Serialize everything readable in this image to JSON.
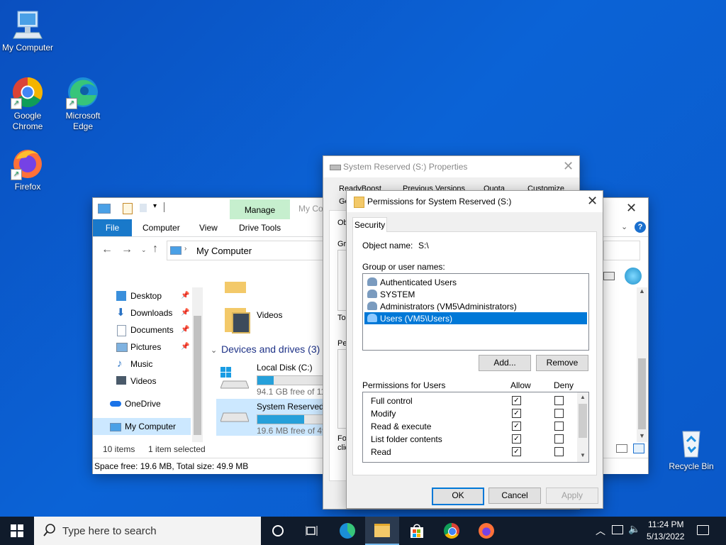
{
  "desktop": {
    "icons": [
      {
        "label": "My Computer"
      },
      {
        "label": "Google Chrome"
      },
      {
        "label": "Microsoft Edge"
      },
      {
        "label": "Firefox"
      },
      {
        "label": "Recycle Bin"
      }
    ]
  },
  "explorer": {
    "quick_access_partial": "My Co",
    "manage_tab": "Manage",
    "ribbon_tabs": [
      "File",
      "Computer",
      "View",
      "Drive Tools"
    ],
    "address": "My Computer",
    "nav_items": [
      "Desktop",
      "Downloads",
      "Documents",
      "Pictures",
      "Music",
      "Videos",
      "OneDrive",
      "My Computer"
    ],
    "folder_videos": "Videos",
    "devices_header": "Devices and drives (3)",
    "drives": [
      {
        "name": "Local Disk (C:)",
        "free": "94.1 GB free of 119",
        "fill": 0.21
      },
      {
        "name": "System Reserved (",
        "free": "19.6 MB free of 49",
        "fill": 0.6
      }
    ],
    "status_items": "10 items",
    "status_selected": "1 item selected",
    "details_bar": "Space free: 19.6 MB, Total size: 49.9 MB"
  },
  "properties": {
    "title": "System Reserved (S:) Properties",
    "tabs_row1": [
      "ReadyBoost",
      "Previous Versions",
      "Quota",
      "Customize"
    ],
    "partial_labels": [
      "Ge",
      "Ob",
      "Gro",
      "To",
      "Pe",
      "Fo",
      "clic"
    ]
  },
  "permissions": {
    "title": "Permissions for System Reserved (S:)",
    "tab": "Security",
    "object_label": "Object name:",
    "object_value": "S:\\",
    "group_label": "Group or user names:",
    "users": [
      {
        "name": "Authenticated Users",
        "selected": false
      },
      {
        "name": "SYSTEM",
        "selected": false
      },
      {
        "name": "Administrators (VM5\\Administrators)",
        "selected": false
      },
      {
        "name": "Users (VM5\\Users)",
        "selected": true
      }
    ],
    "add_button": "Add...",
    "remove_button": "Remove",
    "perms_label": "Permissions for Users",
    "allow_header": "Allow",
    "deny_header": "Deny",
    "perms": [
      {
        "name": "Full control",
        "allow": true,
        "deny": false
      },
      {
        "name": "Modify",
        "allow": true,
        "deny": false
      },
      {
        "name": "Read & execute",
        "allow": true,
        "deny": false
      },
      {
        "name": "List folder contents",
        "allow": true,
        "deny": false
      },
      {
        "name": "Read",
        "allow": true,
        "deny": false
      }
    ],
    "ok_button": "OK",
    "cancel_button": "Cancel",
    "apply_button": "Apply"
  },
  "taskbar": {
    "search_placeholder": "Type here to search",
    "time": "11:24 PM",
    "date": "5/13/2022"
  },
  "colors": {
    "selection": "#0078d7",
    "manage_tab_bg": "#c6efce",
    "file_tab_bg": "#1979ca",
    "drive_bar": "#26a0da"
  }
}
